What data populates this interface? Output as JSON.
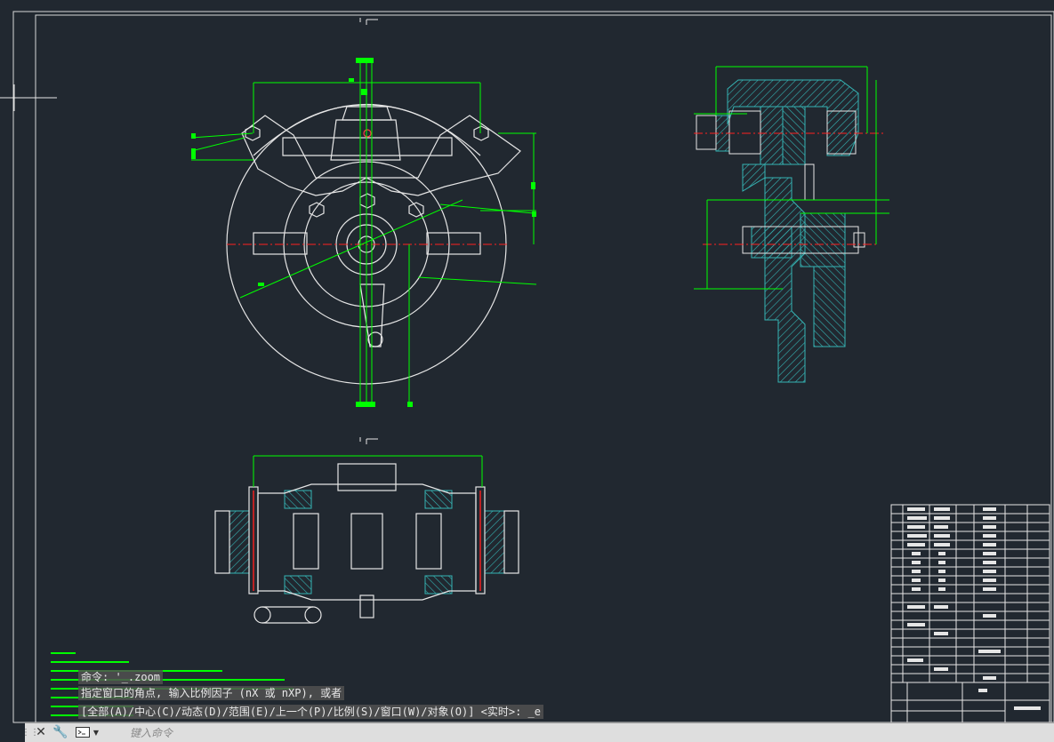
{
  "command_history": {
    "line1": "命令:  '_.zoom",
    "line2": "指定窗口的角点, 输入比例因子 (nX 或 nXP), 或者",
    "line3": "[全部(A)/中心(C)/动态(D)/范围(E)/上一个(P)/比例(S)/窗口(W)/对象(O)] <实时>: _e"
  },
  "command_bar": {
    "placeholder": "键入命令",
    "icons": [
      "drag-grip-icon",
      "close-icon",
      "customize-wrench-icon",
      "command-prompt-icon",
      "dropdown-arrow-icon"
    ]
  },
  "colors": {
    "background": "#212830",
    "linework": "#e6e6e6",
    "dimension": "#00ff00",
    "hatch": "#35b5b5",
    "centerline": "#ff2020",
    "command_bar": "#dedede"
  }
}
